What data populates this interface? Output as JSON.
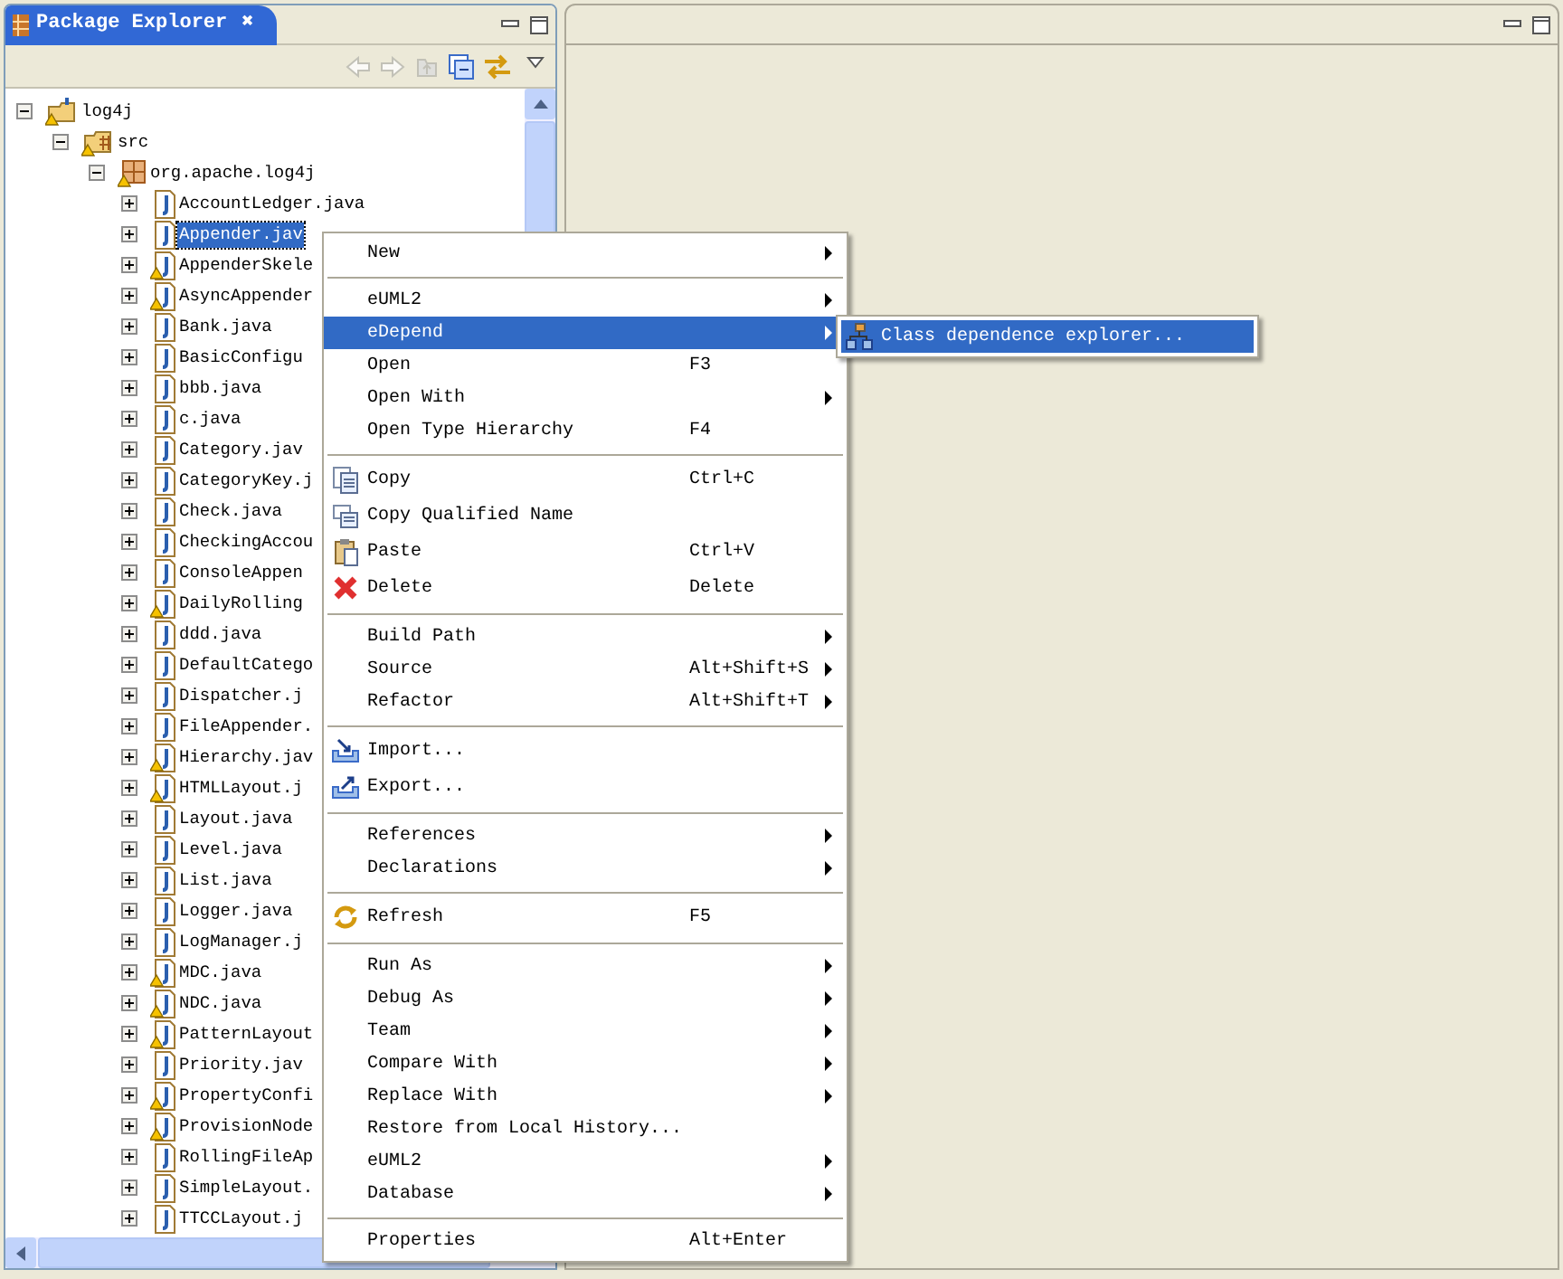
{
  "left_view": {
    "tab": {
      "title": "Package Explorer",
      "close": "✖"
    },
    "toolbar": [
      {
        "kind": "back",
        "disabled": true
      },
      {
        "kind": "forward",
        "disabled": true
      },
      {
        "kind": "up",
        "disabled": true
      },
      {
        "kind": "collapse",
        "disabled": false
      },
      {
        "kind": "link",
        "disabled": false
      },
      {
        "kind": "viewmenu",
        "disabled": false
      }
    ],
    "tree": [
      {
        "label": "log4j",
        "kind": "project",
        "expanded": true,
        "warning": true,
        "selected": false,
        "children": [
          {
            "label": "src",
            "kind": "folder",
            "expanded": true,
            "warning": true,
            "selected": false,
            "children": [
              {
                "label": "org.apache.log4j",
                "kind": "package",
                "expanded": true,
                "warning": true,
                "selected": false,
                "children": [
                  {
                    "label": "AccountLedger.java",
                    "kind": "file",
                    "expanded": false,
                    "warning": false,
                    "selected": false
                  },
                  {
                    "label": "Appender.jav",
                    "kind": "file",
                    "expanded": false,
                    "warning": false,
                    "selected": true
                  },
                  {
                    "label": "AppenderSkele",
                    "kind": "file",
                    "expanded": false,
                    "warning": true,
                    "selected": false
                  },
                  {
                    "label": "AsyncAppender",
                    "kind": "file",
                    "expanded": false,
                    "warning": true,
                    "selected": false
                  },
                  {
                    "label": "Bank.java",
                    "kind": "file",
                    "expanded": false,
                    "warning": false,
                    "selected": false
                  },
                  {
                    "label": "BasicConfigu",
                    "kind": "file",
                    "expanded": false,
                    "warning": false,
                    "selected": false
                  },
                  {
                    "label": "bbb.java",
                    "kind": "file",
                    "expanded": false,
                    "warning": false,
                    "selected": false
                  },
                  {
                    "label": "c.java",
                    "kind": "file",
                    "expanded": false,
                    "warning": false,
                    "selected": false
                  },
                  {
                    "label": "Category.jav",
                    "kind": "file",
                    "expanded": false,
                    "warning": false,
                    "selected": false
                  },
                  {
                    "label": "CategoryKey.j",
                    "kind": "file",
                    "expanded": false,
                    "warning": false,
                    "selected": false
                  },
                  {
                    "label": "Check.java",
                    "kind": "file",
                    "expanded": false,
                    "warning": false,
                    "selected": false
                  },
                  {
                    "label": "CheckingAccou",
                    "kind": "file",
                    "expanded": false,
                    "warning": false,
                    "selected": false
                  },
                  {
                    "label": "ConsoleAppen",
                    "kind": "file",
                    "expanded": false,
                    "warning": false,
                    "selected": false
                  },
                  {
                    "label": "DailyRolling",
                    "kind": "file",
                    "expanded": false,
                    "warning": true,
                    "selected": false
                  },
                  {
                    "label": "ddd.java",
                    "kind": "file",
                    "expanded": false,
                    "warning": false,
                    "selected": false
                  },
                  {
                    "label": "DefaultCatego",
                    "kind": "file",
                    "expanded": false,
                    "warning": false,
                    "selected": false
                  },
                  {
                    "label": "Dispatcher.j",
                    "kind": "file",
                    "expanded": false,
                    "warning": false,
                    "selected": false
                  },
                  {
                    "label": "FileAppender.",
                    "kind": "file",
                    "expanded": false,
                    "warning": false,
                    "selected": false
                  },
                  {
                    "label": "Hierarchy.jav",
                    "kind": "file",
                    "expanded": false,
                    "warning": true,
                    "selected": false
                  },
                  {
                    "label": "HTMLLayout.j",
                    "kind": "file",
                    "expanded": false,
                    "warning": true,
                    "selected": false
                  },
                  {
                    "label": "Layout.java",
                    "kind": "file",
                    "expanded": false,
                    "warning": false,
                    "selected": false
                  },
                  {
                    "label": "Level.java",
                    "kind": "file",
                    "expanded": false,
                    "warning": false,
                    "selected": false
                  },
                  {
                    "label": "List.java",
                    "kind": "file",
                    "expanded": false,
                    "warning": false,
                    "selected": false
                  },
                  {
                    "label": "Logger.java",
                    "kind": "file",
                    "expanded": false,
                    "warning": false,
                    "selected": false
                  },
                  {
                    "label": "LogManager.j",
                    "kind": "file",
                    "expanded": false,
                    "warning": false,
                    "selected": false
                  },
                  {
                    "label": "MDC.java",
                    "kind": "file",
                    "expanded": false,
                    "warning": true,
                    "selected": false
                  },
                  {
                    "label": "NDC.java",
                    "kind": "file",
                    "expanded": false,
                    "warning": true,
                    "selected": false
                  },
                  {
                    "label": "PatternLayout",
                    "kind": "file",
                    "expanded": false,
                    "warning": true,
                    "selected": false
                  },
                  {
                    "label": "Priority.jav",
                    "kind": "file",
                    "expanded": false,
                    "warning": false,
                    "selected": false
                  },
                  {
                    "label": "PropertyConfi",
                    "kind": "file",
                    "expanded": false,
                    "warning": true,
                    "selected": false
                  },
                  {
                    "label": "ProvisionNode",
                    "kind": "file",
                    "expanded": false,
                    "warning": true,
                    "selected": false
                  },
                  {
                    "label": "RollingFileAp",
                    "kind": "file",
                    "expanded": false,
                    "warning": false,
                    "selected": false
                  },
                  {
                    "label": "SimpleLayout.",
                    "kind": "file",
                    "expanded": false,
                    "warning": false,
                    "selected": false
                  },
                  {
                    "label": "TTCCLayout.j",
                    "kind": "file",
                    "expanded": false,
                    "warning": false,
                    "selected": false
                  }
                ]
              }
            ]
          }
        ]
      }
    ]
  },
  "context_menu": [
    {
      "kind": "item",
      "label": "New",
      "submenu": true,
      "selected": false
    },
    {
      "kind": "separator"
    },
    {
      "kind": "item",
      "label": "eUML2",
      "submenu": true,
      "selected": false
    },
    {
      "kind": "item",
      "label": "eDepend",
      "submenu": true,
      "selected": true
    },
    {
      "kind": "item",
      "label": "Open",
      "shortcut": "F3",
      "selected": false
    },
    {
      "kind": "item",
      "label": "Open With",
      "submenu": true,
      "selected": false
    },
    {
      "kind": "item",
      "label": "Open Type Hierarchy",
      "shortcut": "F4",
      "selected": false
    },
    {
      "kind": "separator"
    },
    {
      "kind": "copy",
      "label": "Copy",
      "shortcut": "Ctrl+C",
      "selected": false
    },
    {
      "kind": "copyname",
      "label": "Copy Qualified Name",
      "selected": false
    },
    {
      "kind": "paste",
      "label": "Paste",
      "shortcut": "Ctrl+V",
      "selected": false
    },
    {
      "kind": "delete",
      "label": "Delete",
      "shortcut": "Delete",
      "selected": false
    },
    {
      "kind": "separator"
    },
    {
      "kind": "item",
      "label": "Build Path",
      "submenu": true,
      "selected": false
    },
    {
      "kind": "item",
      "label": "Source",
      "shortcut": "Alt+Shift+S",
      "submenu": true,
      "selected": false
    },
    {
      "kind": "item",
      "label": "Refactor",
      "shortcut": "Alt+Shift+T",
      "submenu": true,
      "selected": false
    },
    {
      "kind": "separator"
    },
    {
      "kind": "import",
      "label": "Import...",
      "selected": false
    },
    {
      "kind": "export",
      "label": "Export...",
      "selected": false
    },
    {
      "kind": "separator"
    },
    {
      "kind": "item",
      "label": "References",
      "submenu": true,
      "selected": false
    },
    {
      "kind": "item",
      "label": "Declarations",
      "submenu": true,
      "selected": false
    },
    {
      "kind": "separator"
    },
    {
      "kind": "refresh",
      "label": "Refresh",
      "shortcut": "F5",
      "selected": false
    },
    {
      "kind": "separator"
    },
    {
      "kind": "item",
      "label": "Run As",
      "submenu": true,
      "selected": false
    },
    {
      "kind": "item",
      "label": "Debug As",
      "submenu": true,
      "selected": false
    },
    {
      "kind": "item",
      "label": "Team",
      "submenu": true,
      "selected": false
    },
    {
      "kind": "item",
      "label": "Compare With",
      "submenu": true,
      "selected": false
    },
    {
      "kind": "item",
      "label": "Replace With",
      "submenu": true,
      "selected": false
    },
    {
      "kind": "item",
      "label": "Restore from Local History...",
      "selected": false
    },
    {
      "kind": "item",
      "label": "eUML2",
      "submenu": true,
      "selected": false
    },
    {
      "kind": "item",
      "label": "Database",
      "submenu": true,
      "selected": false
    },
    {
      "kind": "separator"
    },
    {
      "kind": "item",
      "label": "Properties",
      "shortcut": "Alt+Enter",
      "selected": false
    }
  ],
  "submenu": [
    {
      "label": "Class dependence explorer...",
      "selected": true
    }
  ]
}
